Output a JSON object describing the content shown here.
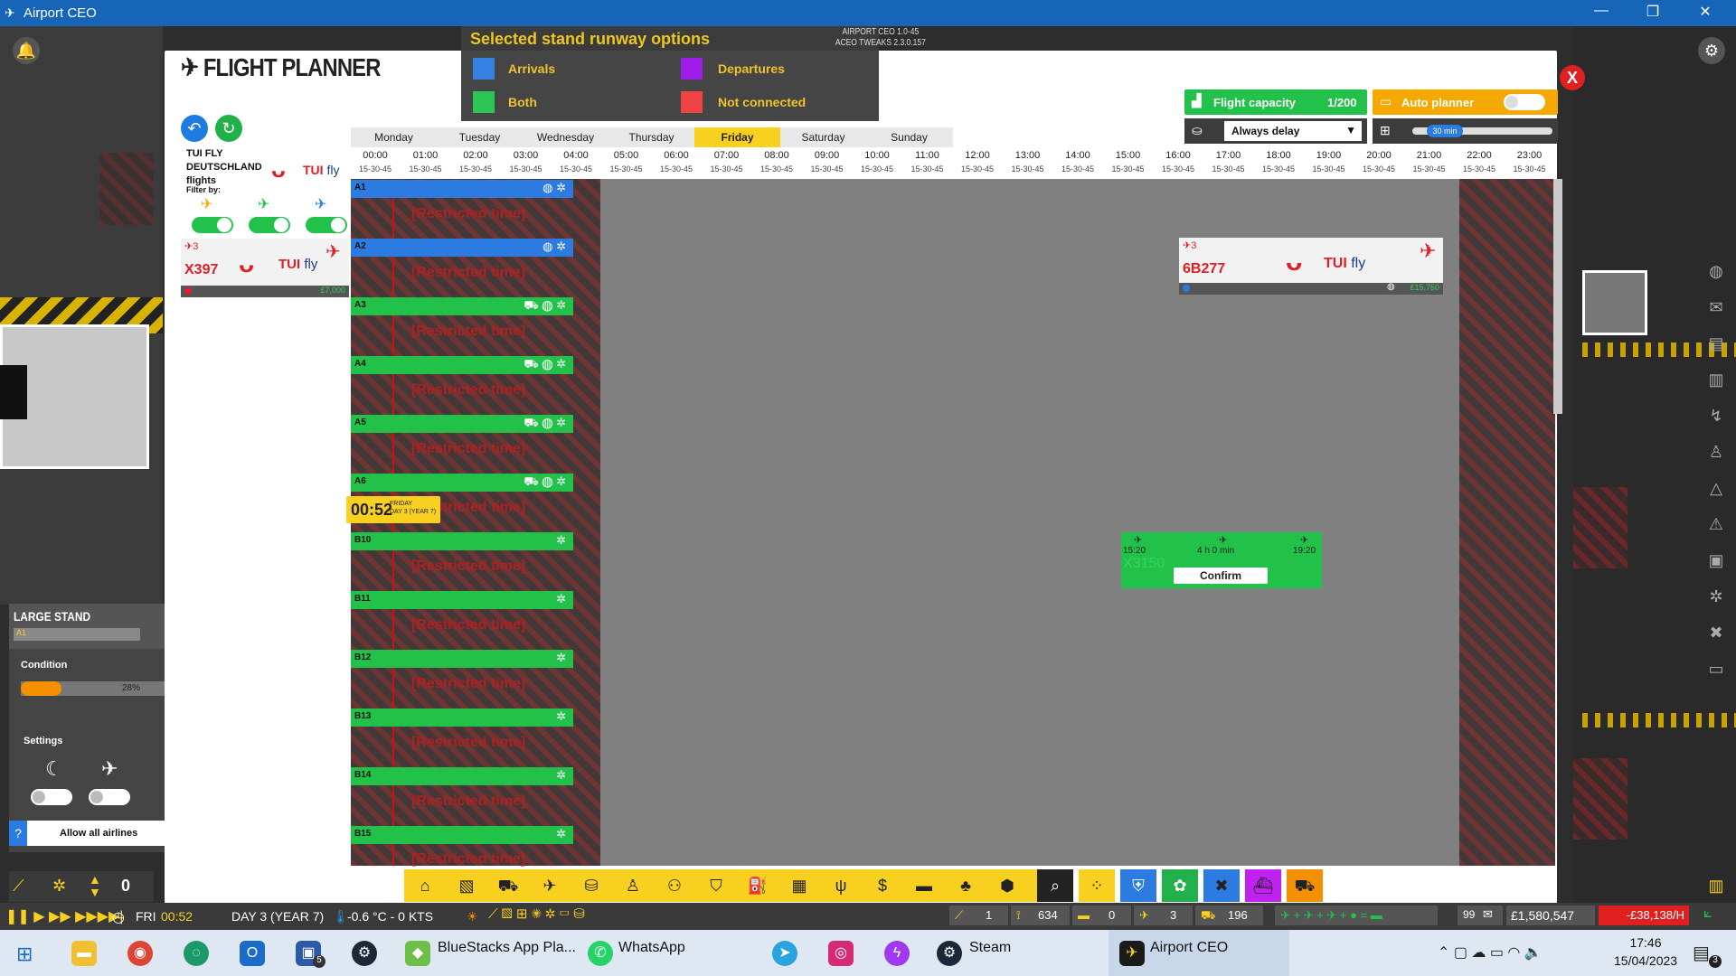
{
  "window": {
    "title": "Airport CEO",
    "min": "—",
    "max": "❐",
    "close": "✕"
  },
  "planner": {
    "title": "FLIGHT PLANNER",
    "close": "X",
    "legend": {
      "heading": "Selected stand runway options",
      "items": [
        {
          "label": "Arrivals",
          "color": "#2b7be0"
        },
        {
          "label": "Departures",
          "color": "#9a10e8"
        },
        {
          "label": "Both",
          "color": "#22c24a"
        },
        {
          "label": "Not connected",
          "color": "#f03a3a"
        }
      ]
    },
    "version": "AIRPORT CEO 1.0-45\nACEO TWEAKS 2.3.0.157",
    "capacity": {
      "label": "Flight capacity",
      "value": "1/200"
    },
    "auto_planner": {
      "label": "Auto planner"
    },
    "delay_select": "Always delay",
    "slider_value": "30 min",
    "airline": {
      "name": "TUI FLY\nDEUTSCHLAND\nflights",
      "logo": "TUI",
      "logo_sub": "fly",
      "filter": "Filter by:"
    },
    "unassigned": {
      "count": "3",
      "code": "X397",
      "price": "£7,000"
    },
    "days": [
      "Monday",
      "Tuesday",
      "Wednesday",
      "Thursday",
      "Friday",
      "Saturday",
      "Sunday"
    ],
    "active_day": "Friday",
    "hours": [
      "00:00",
      "01:00",
      "02:00",
      "03:00",
      "04:00",
      "05:00",
      "06:00",
      "07:00",
      "08:00",
      "09:00",
      "10:00",
      "11:00",
      "12:00",
      "13:00",
      "14:00",
      "15:00",
      "16:00",
      "17:00",
      "18:00",
      "19:00",
      "20:00",
      "21:00",
      "22:00",
      "23:00"
    ],
    "sub_label": "15-30-45",
    "stands": [
      {
        "id": "A1",
        "type": "arr"
      },
      {
        "id": "A2",
        "type": "arr"
      },
      {
        "id": "A3",
        "type": "both"
      },
      {
        "id": "A4",
        "type": "both"
      },
      {
        "id": "A5",
        "type": "both"
      },
      {
        "id": "A6",
        "type": "both"
      },
      {
        "id": "B10",
        "type": "both"
      },
      {
        "id": "B11",
        "type": "both"
      },
      {
        "id": "B12",
        "type": "both"
      },
      {
        "id": "B13",
        "type": "both"
      },
      {
        "id": "B14",
        "type": "both"
      },
      {
        "id": "B15",
        "type": "both"
      }
    ],
    "restricted": "[Restricted time]",
    "time_marker": {
      "time": "00:52",
      "sub": "FRIDAY\nDAY 3 (YEAR 7)"
    },
    "scheduled_flight": {
      "count": "3",
      "code": "6B277",
      "price": "£15,750"
    },
    "placement": {
      "start": "15:20",
      "duration": "4 h 0 min",
      "end": "19:20",
      "ghost": "X3150",
      "confirm": "Confirm"
    }
  },
  "stand_panel": {
    "title": "LARGE STAND",
    "id": "A1",
    "condition_label": "Condition",
    "condition_value": "28%",
    "condition": 0.28,
    "settings_label": "Settings",
    "allow_airlines": "Allow all airlines"
  },
  "status": {
    "day": "FRI",
    "time": "00:52",
    "date": "DAY 3 (YEAR 7)",
    "weather": "-0.6 °C - 0 KTS",
    "s1": "1",
    "s2": "634",
    "s3": "0",
    "s4": "3",
    "s5": "196",
    "mail": "99",
    "money": "£1,580,547",
    "rate": "-£38,138/H",
    "speed": "0"
  },
  "taskbar": {
    "bluestacks": "BlueStacks App Pla...",
    "whatsapp": "WhatsApp",
    "steam": "Steam",
    "airport": "Airport CEO",
    "time": "17:46",
    "date": "15/04/2023",
    "notif": "3",
    "outlook_badge": "5"
  }
}
